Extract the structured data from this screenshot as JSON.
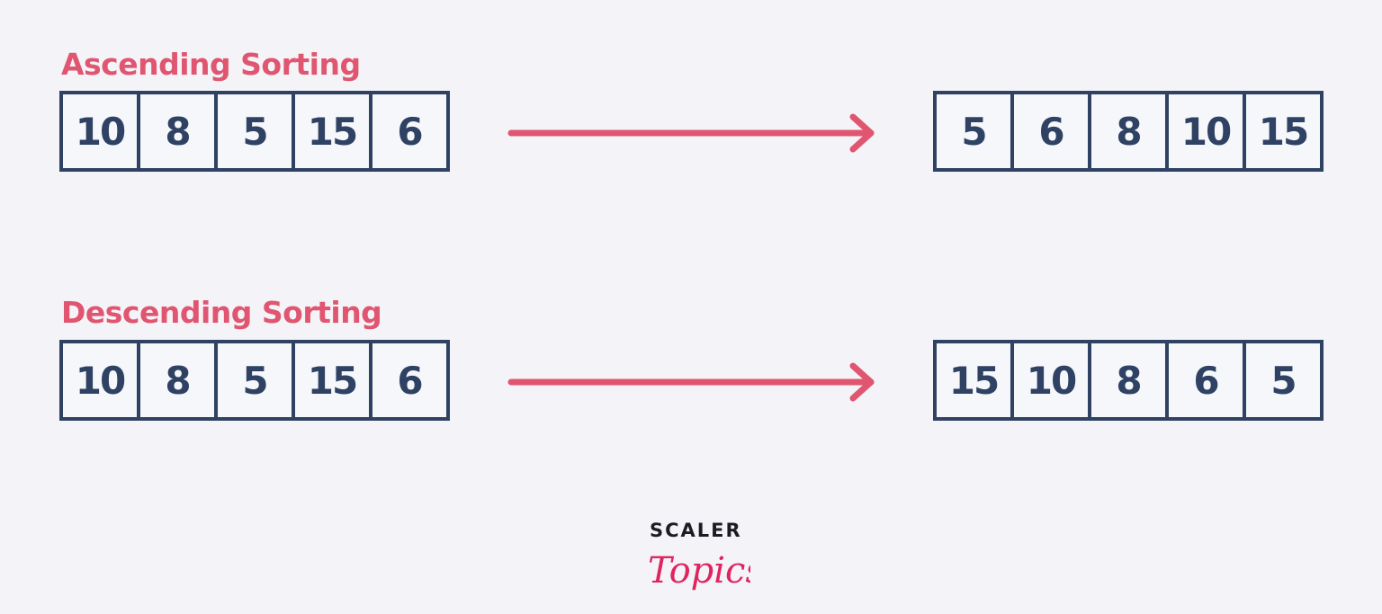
{
  "colors": {
    "background": "#f4f4f8",
    "accent": "#e05670",
    "box_border": "#2f4263",
    "box_fill": "#f5f7fb",
    "number_text": "#2f4263"
  },
  "sections": [
    {
      "title": "Ascending Sorting",
      "input": [
        10,
        8,
        5,
        15,
        6
      ],
      "output": [
        5,
        6,
        8,
        10,
        15
      ],
      "arrow_icon": "arrow-right-icon"
    },
    {
      "title": "Descending Sorting",
      "input": [
        10,
        8,
        5,
        15,
        6
      ],
      "output": [
        15,
        10,
        8,
        6,
        5
      ],
      "arrow_icon": "arrow-right-icon"
    }
  ],
  "logo": {
    "top": "SCALER",
    "script": "Topics"
  }
}
